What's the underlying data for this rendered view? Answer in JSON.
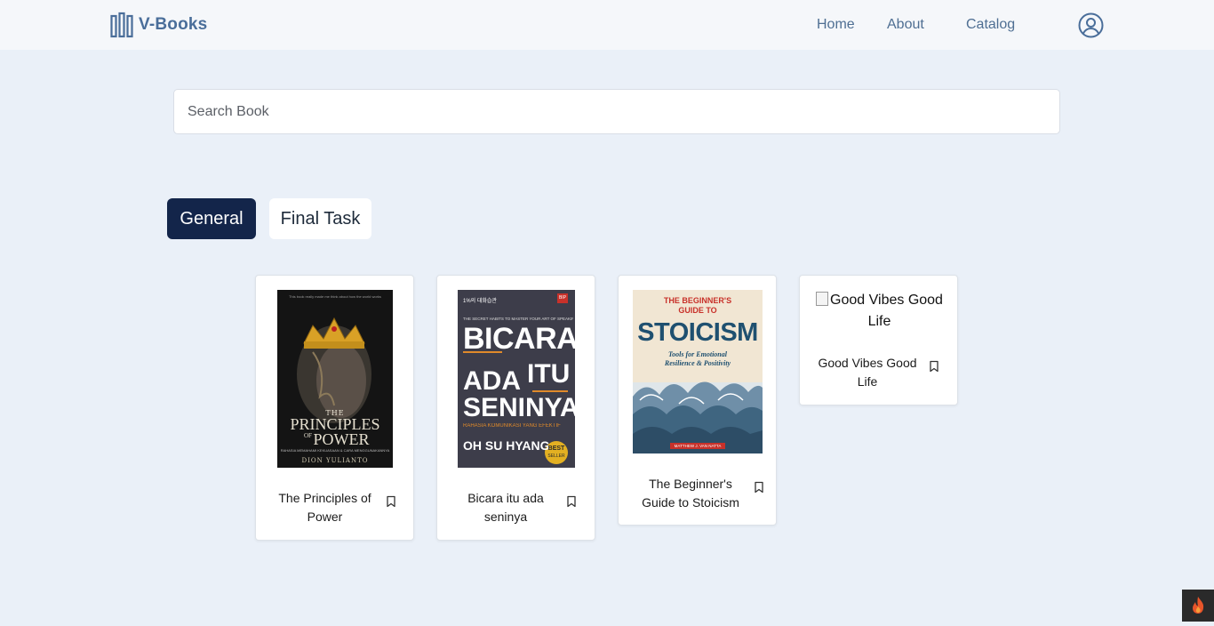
{
  "nav": {
    "brand": "V-Books",
    "links": [
      "Home",
      "About",
      "Catalog"
    ]
  },
  "search": {
    "placeholder": "Search Book",
    "value": ""
  },
  "tabs": [
    {
      "label": "General",
      "active": true
    },
    {
      "label": "Final Task",
      "active": false
    }
  ],
  "books": [
    {
      "title": "The Principles of Power",
      "cover": {
        "top_quote": "This book really made me think about how the world works",
        "the": "THE",
        "principles": "PRINCIPLES",
        "of": "OF",
        "power": "POWER",
        "subtitle": "RAHASIA MEMAHAMI KEKUASAAN & CARA MENGGUNAKANNYA",
        "author": "DION YULIANTO"
      }
    },
    {
      "title": "Bicara itu ada seninya",
      "cover": {
        "top_label": "1%의 대화습관",
        "tagline": "THE SECRET HABITS TO MASTER YOUR ART OF SPEAKING!",
        "publisher_badge": "BIP",
        "line1": "BICARA",
        "line2a": "ADA",
        "line2b": "ITU",
        "line3": "SENINYA",
        "subtitle": "RAHASIA KOMUNIKASI YANG EFEKTIF",
        "author": "OH SU HYANG",
        "badge_top": "BEST",
        "badge_bottom": "SELLER"
      }
    },
    {
      "title": "The Beginner's Guide to Stoicism",
      "cover": {
        "kicker_line1": "THE BEGINNER'S",
        "kicker_line2": "GUIDE TO",
        "main": "STOICISM",
        "subtitle_line1": "Tools for Emotional",
        "subtitle_line2": "Resilience & Positivity",
        "author": "MATTHEW J. VAN NATTA"
      }
    },
    {
      "title": "Good Vibes Good Life",
      "cover_alt": "Good Vibes Good Life"
    }
  ],
  "colors": {
    "page_bg": "#eaf0f8",
    "nav_bg": "#f5f7fa",
    "brand": "#4a6e9a",
    "active_tab": "#13254a",
    "card_bg": "#ffffff"
  },
  "icons": [
    "logo-bars-icon",
    "user-circle-icon",
    "bookmark-icon",
    "flame-icon"
  ]
}
